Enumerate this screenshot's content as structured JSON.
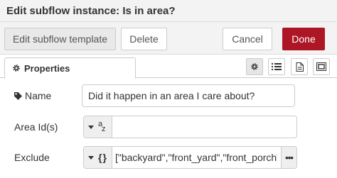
{
  "window": {
    "title": "Edit subflow instance: Is in area?"
  },
  "toolbar": {
    "edit_template_label": "Edit subflow template",
    "delete_label": "Delete",
    "cancel_label": "Cancel",
    "done_label": "Done"
  },
  "tabs": [
    {
      "label": "Properties",
      "icon": "gear-icon"
    }
  ],
  "tab_actions": [
    {
      "icon": "gear-icon",
      "active": true
    },
    {
      "icon": "list-icon",
      "active": false
    },
    {
      "icon": "document-icon",
      "active": false
    },
    {
      "icon": "frame-icon",
      "active": false
    }
  ],
  "form": {
    "name": {
      "label": "Name",
      "icon": "tag-icon",
      "value": "Did it happen in an area I care about?"
    },
    "area_ids": {
      "label": "Area Id(s)",
      "type_a": "a",
      "type_z": "z",
      "value": ""
    },
    "exclude": {
      "label": "Exclude",
      "type_symbol": "{}",
      "value": "[\"backyard\",\"front_yard\",\"front_porch\",\"n",
      "expand": "•••"
    }
  },
  "colors": {
    "done_button": "#ad1625",
    "toolbar_bg": "#f3f3f3",
    "border": "#cccccc"
  }
}
